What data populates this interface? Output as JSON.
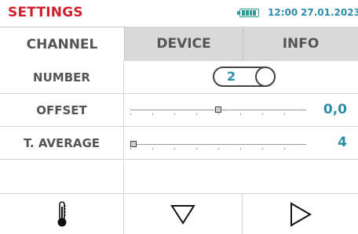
{
  "header": {
    "title": "SETTINGS",
    "time": "12:00",
    "date": "27.01.2023"
  },
  "tabs": [
    {
      "label": "CHANNEL",
      "active": true
    },
    {
      "label": "DEVICE",
      "active": false
    },
    {
      "label": "INFO",
      "active": false
    }
  ],
  "rows": {
    "number": {
      "label": "NUMBER",
      "value": "2"
    },
    "offset": {
      "label": "OFFSET",
      "value": "0,0",
      "position": 0.5
    },
    "average": {
      "label": "T. AVERAGE",
      "value": "4",
      "position": 0.0
    }
  },
  "footer": {
    "buttons": [
      "thermometer-icon",
      "triangle-down-icon",
      "triangle-right-icon"
    ]
  },
  "colors": {
    "title": "#d11f2a",
    "accent": "#2e8cab",
    "battery": "#2f9a8f",
    "inactive_tab": "#d9d9d9"
  }
}
